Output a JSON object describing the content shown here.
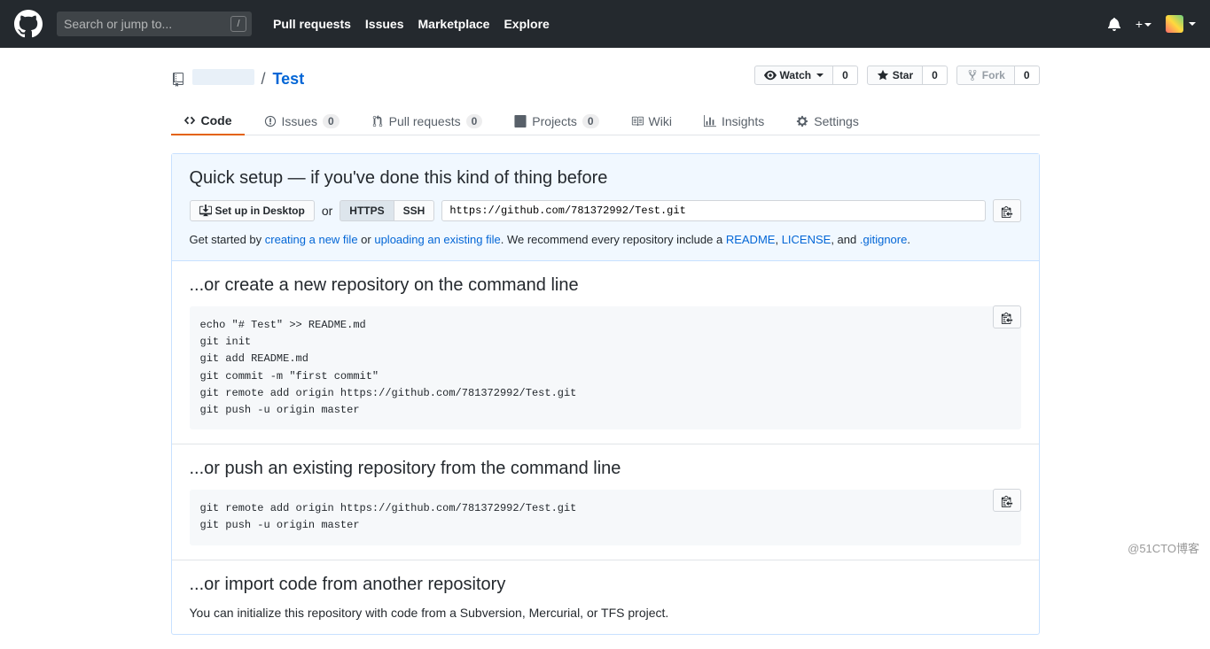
{
  "header": {
    "search_placeholder": "Search or jump to...",
    "nav": [
      "Pull requests",
      "Issues",
      "Marketplace",
      "Explore"
    ]
  },
  "repo": {
    "separator": "/",
    "name": "Test",
    "actions": {
      "watch": {
        "label": "Watch",
        "count": "0"
      },
      "star": {
        "label": "Star",
        "count": "0"
      },
      "fork": {
        "label": "Fork",
        "count": "0"
      }
    }
  },
  "tabs": [
    {
      "label": "Code",
      "count": null,
      "active": true
    },
    {
      "label": "Issues",
      "count": "0"
    },
    {
      "label": "Pull requests",
      "count": "0"
    },
    {
      "label": "Projects",
      "count": "0"
    },
    {
      "label": "Wiki",
      "count": null
    },
    {
      "label": "Insights",
      "count": null
    },
    {
      "label": "Settings",
      "count": null
    }
  ],
  "setup": {
    "title": "Quick setup — if you've done this kind of thing before",
    "desktop_btn": "Set up in Desktop",
    "or": "or",
    "https_btn": "HTTPS",
    "ssh_btn": "SSH",
    "url": "https://github.com/781372992/Test.git",
    "help_pre": "Get started by ",
    "help_link1": "creating a new file",
    "help_mid": " or ",
    "help_link2": "uploading an existing file",
    "help_post": ". We recommend every repository include a ",
    "help_link3": "README",
    "help_comma": ", ",
    "help_link4": "LICENSE",
    "help_and": ", and ",
    "help_link5": ".gitignore",
    "help_end": "."
  },
  "section1": {
    "title": "...or create a new repository on the command line",
    "code": "echo \"# Test\" >> README.md\ngit init\ngit add README.md\ngit commit -m \"first commit\"\ngit remote add origin https://github.com/781372992/Test.git\ngit push -u origin master"
  },
  "section2": {
    "title": "...or push an existing repository from the command line",
    "code": "git remote add origin https://github.com/781372992/Test.git\ngit push -u origin master"
  },
  "section3": {
    "title": "...or import code from another repository",
    "desc": "You can initialize this repository with code from a Subversion, Mercurial, or TFS project."
  },
  "watermark": "@51CTO博客"
}
